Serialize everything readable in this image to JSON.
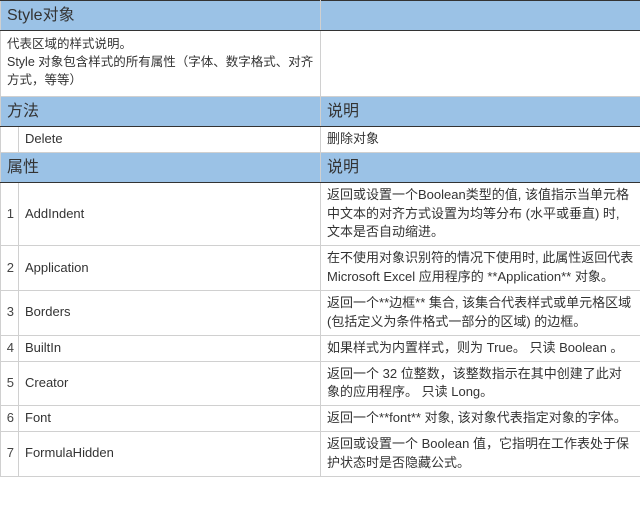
{
  "title": "Style对象",
  "intro": "代表区域的样式说明。\nStyle 对象包含样式的所有属性（字体、数字格式、对齐方式，等等）",
  "methods_header": {
    "left": "方法",
    "right": "说明"
  },
  "methods": [
    {
      "name": "Delete",
      "desc": "删除对象"
    }
  ],
  "props_header": {
    "left": "属性",
    "right": "说明"
  },
  "properties": [
    {
      "idx": "1",
      "name": "AddIndent",
      "desc": "返回或设置一个Boolean类型的值, 该值指示当单元格中文本的对齐方式设置为均等分布 (水平或垂直) 时, 文本是否自动缩进。"
    },
    {
      "idx": "2",
      "name": "Application",
      "desc": "在不使用对象识别符的情况下使用时, 此属性返回代表 Microsoft Excel 应用程序的 **Application** 对象。"
    },
    {
      "idx": "3",
      "name": "Borders",
      "desc": "返回一个**边框** 集合, 该集合代表样式或单元格区域 (包括定义为条件格式一部分的区域) 的边框。"
    },
    {
      "idx": "4",
      "name": "BuiltIn",
      "desc": "如果样式为内置样式，则为 True。 只读 Boolean 。"
    },
    {
      "idx": "5",
      "name": "Creator",
      "desc": "返回一个 32 位整数，该整数指示在其中创建了此对象的应用程序。 只读 Long。"
    },
    {
      "idx": "6",
      "name": "Font",
      "desc": "返回一个**font** 对象, 该对象代表指定对象的字体。"
    },
    {
      "idx": "7",
      "name": "FormulaHidden",
      "desc": "返回或设置一个 Boolean 值，它指明在工作表处于保护状态时是否隐藏公式。"
    }
  ]
}
